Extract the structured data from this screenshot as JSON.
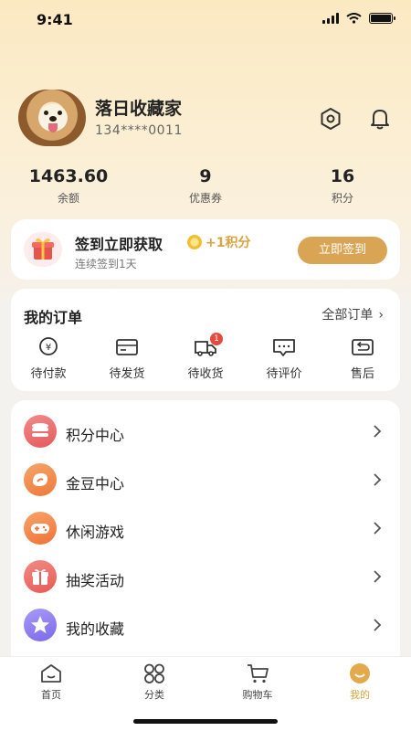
{
  "status_bar": {
    "time": "9:41"
  },
  "profile": {
    "nickname": "落日收藏家",
    "phone": "134****0011"
  },
  "stats": [
    {
      "value": "1463.60",
      "label": "余额"
    },
    {
      "value": "9",
      "label": "优惠券"
    },
    {
      "value": "16",
      "label": "积分"
    }
  ],
  "checkin": {
    "title": "签到立即获取",
    "points": "+1积分",
    "subtitle": "连续签到1天",
    "button": "立即签到"
  },
  "orders": {
    "title": "我的订单",
    "all_link": "全部订单",
    "items": [
      {
        "label": "待付款",
        "icon": "payment-icon"
      },
      {
        "label": "待发货",
        "icon": "box-icon"
      },
      {
        "label": "待收货",
        "icon": "truck-icon",
        "badge": "1"
      },
      {
        "label": "待评价",
        "icon": "comment-icon"
      },
      {
        "label": "售后",
        "icon": "return-icon"
      }
    ]
  },
  "menu": [
    {
      "label": "积分中心",
      "icon": "points-stack-icon",
      "color": "#ea6b6b"
    },
    {
      "label": "金豆中心",
      "icon": "bean-icon",
      "color": "#ef8a4a"
    },
    {
      "label": "休闲游戏",
      "icon": "gamepad-icon",
      "color": "#f08248"
    },
    {
      "label": "抽奖活动",
      "icon": "gift-icon",
      "color": "#ee6a6a"
    },
    {
      "label": "我的收藏",
      "icon": "star-icon",
      "color": "#8b7cf0"
    }
  ],
  "tabbar": [
    {
      "label": "首页",
      "icon": "home-icon"
    },
    {
      "label": "分类",
      "icon": "category-icon"
    },
    {
      "label": "购物车",
      "icon": "cart-icon"
    },
    {
      "label": "我的",
      "icon": "profile-face-icon",
      "active": true
    }
  ],
  "colors": {
    "accent": "#d9a555",
    "badge": "#e54b3c"
  }
}
